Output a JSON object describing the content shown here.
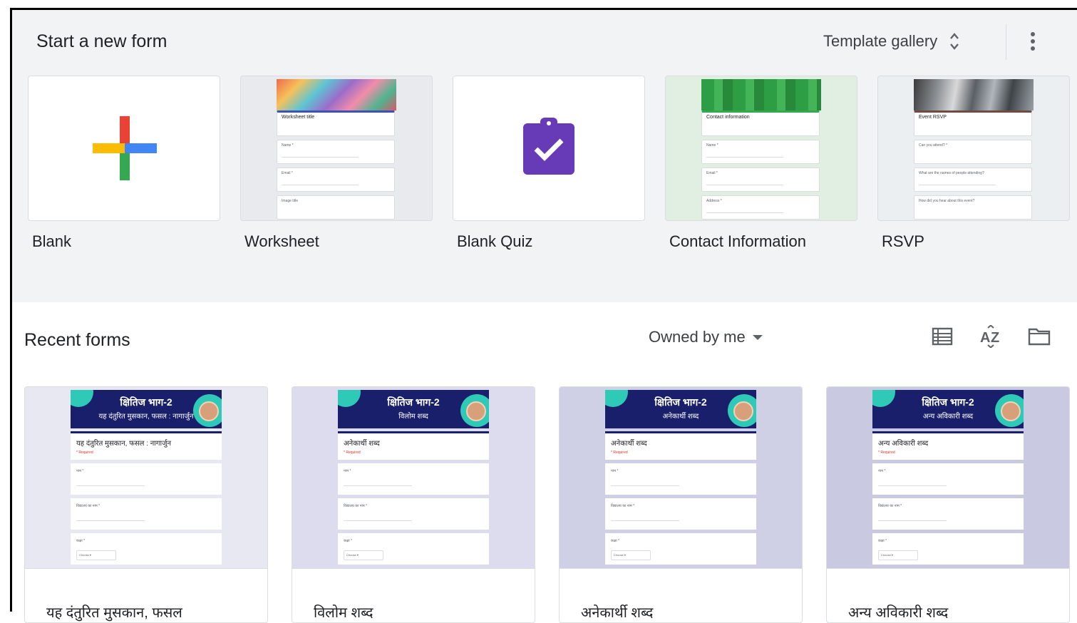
{
  "start": {
    "title": "Start a new form",
    "template_gallery_label": "Template gallery",
    "templates": [
      {
        "label": "Blank"
      },
      {
        "label": "Worksheet",
        "preview_title": "Worksheet title",
        "questions": [
          "Name *",
          "Email *",
          "Image title"
        ]
      },
      {
        "label": "Blank Quiz"
      },
      {
        "label": "Contact Information",
        "preview_title": "Contact information",
        "questions": [
          "Name *",
          "Email *",
          "Address *"
        ]
      },
      {
        "label": "RSVP",
        "preview_title": "Event RSVP",
        "questions": [
          "Can you attend? *",
          "What are the names of people attending?",
          "How did you hear about this event?"
        ]
      }
    ]
  },
  "recent": {
    "title": "Recent forms",
    "owned_by_label": "Owned by me",
    "forms": [
      {
        "banner_title": "क्षितिज भाग-2",
        "banner_subtitle": "यह दंतुरित मुसकान, फसल : नागार्जुन",
        "form_title": "यह दंतुरित मुसकान, फसल : नागार्जुन",
        "name": "यह दंतुरित मुसकान, फसल"
      },
      {
        "banner_title": "क्षितिज भाग-2",
        "banner_subtitle": "विलोम शब्द",
        "form_title": "अनेकार्थी शब्द",
        "name": "विलोम शब्द"
      },
      {
        "banner_title": "क्षितिज भाग-2",
        "banner_subtitle": "अनेकार्थी शब्द",
        "form_title": "अनेकार्थी शब्द",
        "name": "अनेकार्थी शब्द"
      },
      {
        "banner_title": "क्षितिज भाग-2",
        "banner_subtitle": "अन्य अविकारी शब्द",
        "form_title": "अन्य अविकारी शब्द",
        "name": "अन्य अविकारी शब्द"
      }
    ]
  },
  "icons": {
    "more": "more-vert-icon",
    "expand": "unfold-icon",
    "list_view": "list-view-icon",
    "sort": "sort-az-icon",
    "folder": "folder-icon",
    "blank_plus": "google-plus-icon",
    "quiz": "quiz-clipboard-icon"
  },
  "colors": {
    "section_bg": "#f1f3f4",
    "quiz_purple": "#673ab7",
    "banner_navy": "#1a1f6b",
    "accent_teal": "#2fc9b8"
  }
}
